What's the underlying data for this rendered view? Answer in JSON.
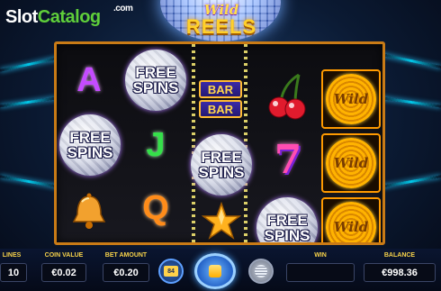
{
  "brand": {
    "name_main": "Slot",
    "name_accent": "Catalog",
    "suffix": ".com"
  },
  "game_logo": {
    "line1": "Wild",
    "line2": "REELS"
  },
  "reels": [
    {
      "symbols": [
        "A",
        "FREE SPINS",
        "Bell"
      ]
    },
    {
      "symbols": [
        "FREE SPINS",
        "J",
        "Q"
      ]
    },
    {
      "symbols": [
        "BAR",
        "BAR",
        "FREE SPINS",
        "Star"
      ]
    },
    {
      "symbols": [
        "Cherries",
        "7",
        "FREE SPINS"
      ]
    },
    {
      "symbols": [
        "Wild",
        "Wild",
        "Wild"
      ]
    }
  ],
  "symbol_text": {
    "free_line1": "FREE",
    "free_line2": "SPINS",
    "letter_a": "A",
    "letter_j": "J",
    "letter_q": "Q",
    "bar": "BAR",
    "seven": "7",
    "wild": "Wild"
  },
  "hud": {
    "lines_label": "LINES",
    "lines_value": "10",
    "coin_value_label": "COIN VALUE",
    "coin_value": "€0.02",
    "bet_amount_label": "BET AMOUNT",
    "bet_amount": "€0.20",
    "autoplay_badge": "84",
    "win_label": "WIN",
    "win_value": "",
    "balance_label": "BALANCE",
    "balance_value": "€998.36"
  },
  "icons": {
    "autoplay": "autoplay-icon",
    "spin": "spin-icon",
    "coins": "coin-stack-icon",
    "bell": "bell-icon",
    "cherries": "cherries-icon",
    "star": "star-icon",
    "disco_ball": "disco-ball-icon"
  },
  "colors": {
    "frame": "#c97b16",
    "label_gold": "#f7d24a",
    "brand_green": "#5fcf3a"
  }
}
